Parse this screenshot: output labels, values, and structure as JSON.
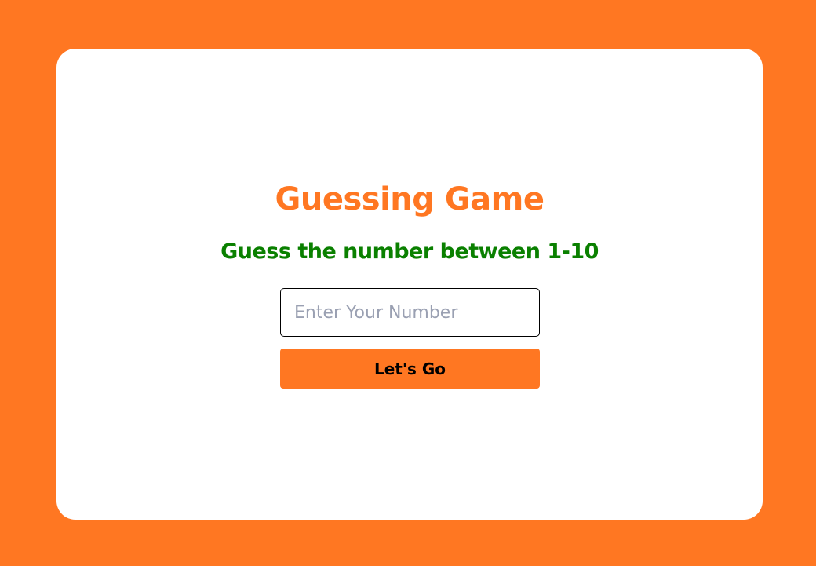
{
  "page": {
    "background_color": "#ff7722",
    "card_color": "#ffffff"
  },
  "game": {
    "title": "Guessing Game",
    "title_color": "#ff7722",
    "subtitle": "Guess the number between 1-10",
    "subtitle_color": "#0a8000"
  },
  "guess_input": {
    "value": "",
    "placeholder": "Enter Your Number"
  },
  "submit_button": {
    "label": "Let's Go",
    "color": "#ff7722"
  }
}
